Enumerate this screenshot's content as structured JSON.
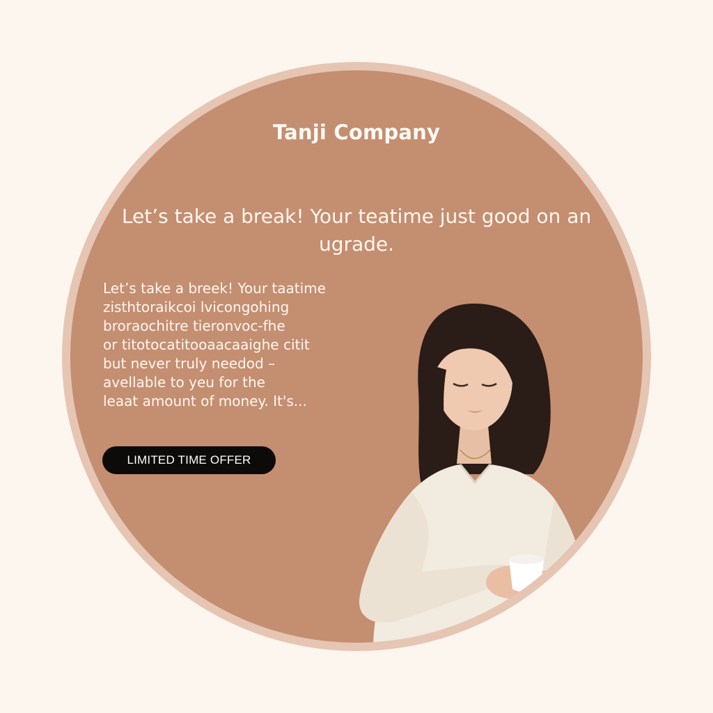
{
  "brand": {
    "name": "Tanji Company"
  },
  "hero": {
    "headline": "Let’s take a break! Your teatime just good on an ugrade.",
    "body_lines": [
      "Let’s take a breek! Your taatime",
      "zisthtoraikcoi lvicongohing",
      "broraochitre tieronvoc-fhe",
      "or titotocatitooaacaaighe citit",
      "but never truly needod –",
      "avellable to yeu for the",
      "leaat amount of money. It's..."
    ],
    "cta_label": "LIMITED TIME OFFER"
  },
  "colors": {
    "page_bg": "#fcf6ee",
    "ring": "#e6c5b3",
    "circle": "#c48e71",
    "button": "#0d0b0a",
    "sweater": "#f2ebdf",
    "hair": "#2a1c17"
  },
  "icons": {
    "photo": "woman-holding-tea-cup-illustration"
  }
}
